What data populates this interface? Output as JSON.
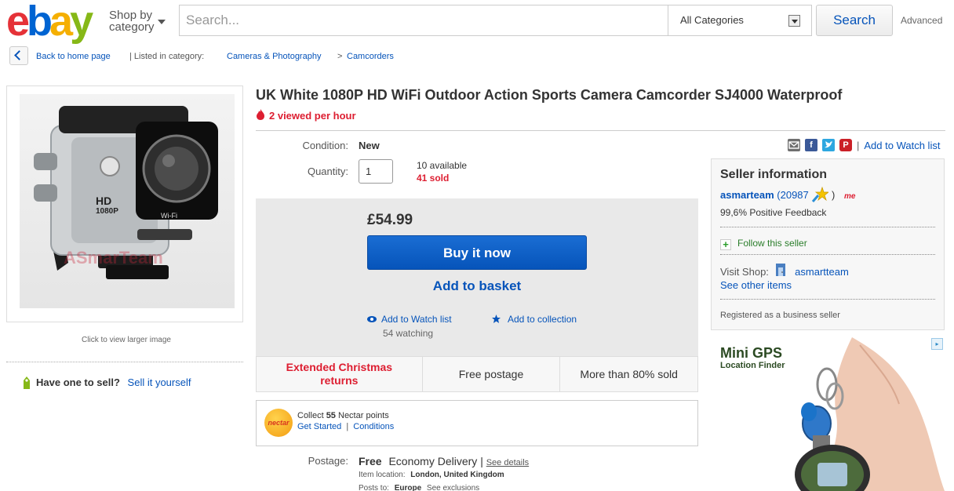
{
  "header": {
    "logo_letters": [
      "e",
      "b",
      "a",
      "y"
    ],
    "logo_colors": [
      "#e53238",
      "#0064d2",
      "#f5af02",
      "#86b817"
    ],
    "shop_by_line1": "Shop by",
    "shop_by_line2": "category",
    "search_placeholder": "Search...",
    "category_selected": "All Categories",
    "search_button": "Search",
    "advanced": "Advanced"
  },
  "breadcrumb": {
    "back": "Back to home page",
    "listed_in": "| Listed in category:",
    "category": "Cameras & Photography",
    "separator": ">",
    "subcategory": "Camcorders"
  },
  "image": {
    "click_to_view": "Click to view larger image",
    "camera_label": "HD",
    "camera_sublabel": "1080P",
    "wifi_label": "Wi-Fi",
    "watermark": "ASmarTeam"
  },
  "sell": {
    "question": "Have one to sell?",
    "link": "Sell it yourself"
  },
  "item": {
    "title": "UK White 1080P HD WiFi Outdoor Action Sports Camera Camcorder SJ4000 Waterproof",
    "viewed": "2 viewed per hour",
    "condition_label": "Condition:",
    "condition": "New",
    "quantity_label": "Quantity:",
    "quantity": "1",
    "available": "10 available",
    "sold": "41 sold"
  },
  "buy": {
    "price": "£54.99",
    "buy_now": "Buy it now",
    "add_to_basket": "Add to basket",
    "watch": "Add to Watch list",
    "collection": "Add to collection",
    "watching": "54 watching"
  },
  "features": [
    "Extended Christmas returns",
    "Free postage",
    "More than 80% sold"
  ],
  "nectar": {
    "logo": "nectar",
    "collect_prefix": "Collect",
    "points": "55",
    "collect_suffix": "Nectar points",
    "get_started": "Get Started",
    "sep": "|",
    "conditions": "Conditions"
  },
  "postage": {
    "label": "Postage:",
    "free": "Free",
    "service": "Economy Delivery",
    "sep": "|",
    "details": "See details",
    "location_label": "Item location:",
    "location": "London, United Kingdom",
    "posts_label": "Posts to:",
    "posts_to": "Europe",
    "exclusions": "See exclusions"
  },
  "share": {
    "sep": "|",
    "watch": "Add to Watch list"
  },
  "seller": {
    "heading": "Seller information",
    "name": "asmarteam",
    "score": "(20987",
    "score_close": ")",
    "me_badge": "me",
    "feedback": "99,6% Positive Feedback",
    "follow": "Follow this seller",
    "visit_label": "Visit Shop:",
    "shop_name": "asmartteam",
    "other_items": "See other items",
    "registered": "Registered as a business seller"
  },
  "ad": {
    "title": "Mini GPS",
    "subtitle": "Location Finder"
  }
}
